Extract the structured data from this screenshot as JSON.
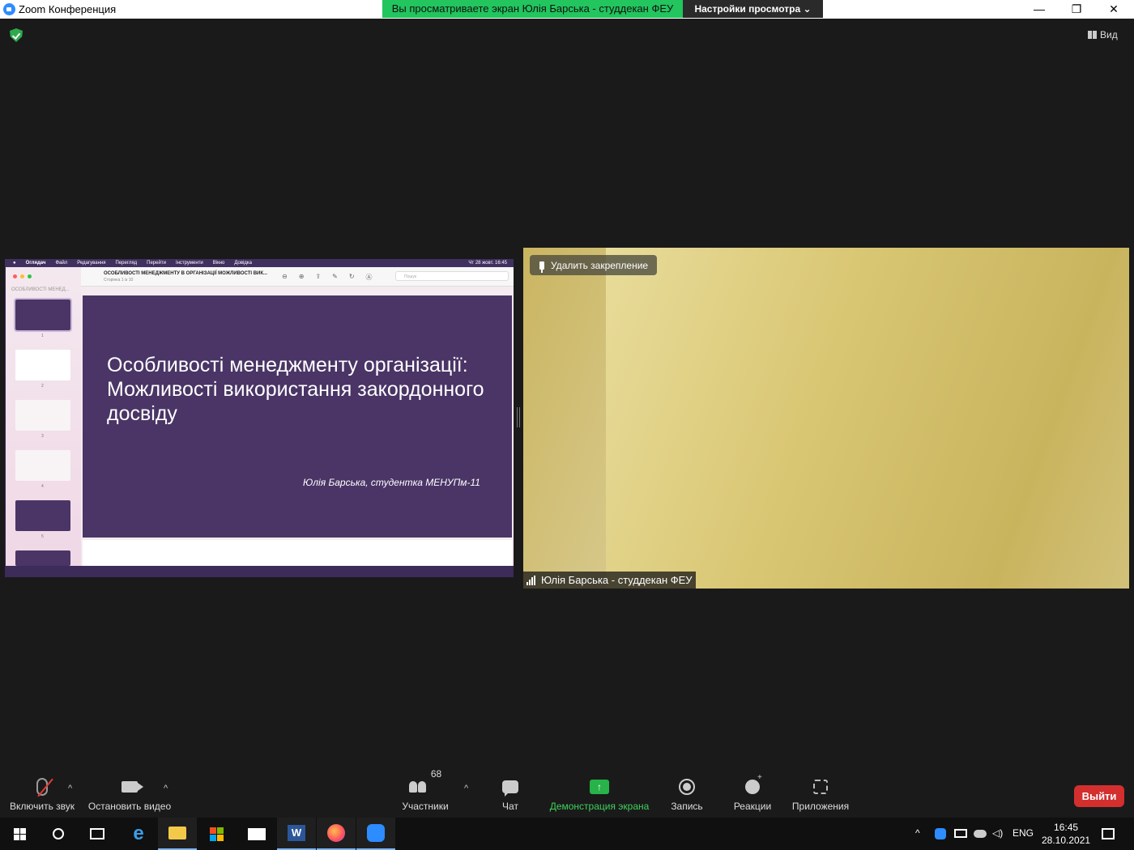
{
  "window": {
    "title": "Zoom Конференция",
    "minimize": "—",
    "restore": "❐",
    "close": "✕"
  },
  "banner": {
    "sharing_text": "Вы просматриваете экран Юлія Барська - студдекан ФЕУ",
    "view_settings": "Настройки просмотра ⌄"
  },
  "top_right": {
    "view_label": "Вид"
  },
  "shared_screen": {
    "menubar": [
      "",
      "Оглядач",
      "Файл",
      "Редагування",
      "Перегляд",
      "Перейти",
      "Інструменти",
      "Вікно",
      "Довідка"
    ],
    "menubar_clock": "Чт 28 жовт. 16:45",
    "sidebar_title": "ОСОБЛИВОСТІ МЕНЕД...",
    "thumb_numbers": [
      "1",
      "2",
      "3",
      "4",
      "5"
    ],
    "doc_title": "ОСОБЛИВОСТІ МЕНЕДЖМЕНТУ В ОРГАНІЗАЦІЇ МОЖЛИВОСТІ ВИК...",
    "doc_subtitle": "Сторінка 1 із 10",
    "search_placeholder": "Пошук",
    "slide_title": "Особливості менеджменту організації: Можливості використання закордонного досвіду",
    "slide_author": "Юлія Барська, студентка МЕНУПм-11"
  },
  "video": {
    "unpin_label": "Удалить закрепление",
    "participant_name": "Юлія Барська - студдекан ФЕУ"
  },
  "controls": {
    "mute_label": "Включить звук",
    "video_label": "Остановить видео",
    "participants_label": "Участники",
    "participants_count": "68",
    "chat_label": "Чат",
    "share_label": "Демонстрация экрана",
    "record_label": "Запись",
    "reactions_label": "Реакции",
    "apps_label": "Приложения",
    "leave_label": "Выйти",
    "caret": "^"
  },
  "taskbar": {
    "language": "ENG",
    "time": "16:45",
    "date": "28.10.2021"
  },
  "colors": {
    "share_green": "#22c55e",
    "leave_red": "#d32f2f",
    "zoom_blue": "#2d8cff",
    "slide_purple": "#4a3566"
  }
}
